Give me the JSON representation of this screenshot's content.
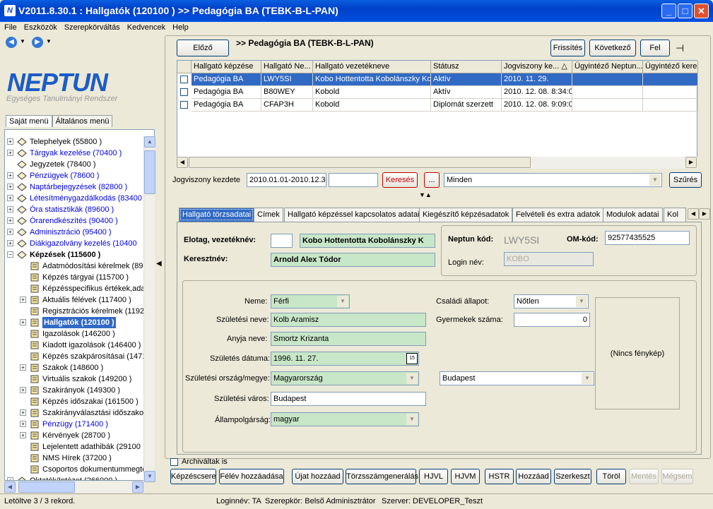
{
  "window": {
    "title": "V2011.8.30.1 : Hallgatók (120100  )  >> Pedagógia BA (TEBK-B-L-PAN)",
    "app_icon_glyph": "N"
  },
  "menu": [
    "File",
    "Eszközök",
    "Szerepkörváltás",
    "Kedvencek",
    "Help"
  ],
  "logo": {
    "text": "NEPTUN",
    "subtitle": "Egységes Tanulmányi Rendszer",
    "color": "#1a5cc8"
  },
  "left_tabs": [
    "Saját menü",
    "Általános menü"
  ],
  "tree": [
    {
      "label": "Telephelyek (55800  )",
      "blue": false,
      "level": 0,
      "exp": "+"
    },
    {
      "label": "Tárgyak kezelése (70400  )",
      "blue": true,
      "level": 0,
      "exp": "+"
    },
    {
      "label": "Jegyzetek (78400  )",
      "blue": false,
      "level": 0,
      "exp": ""
    },
    {
      "label": "Pénzügyek (78600  )",
      "blue": true,
      "level": 0,
      "exp": "+"
    },
    {
      "label": "Naptárbejegyzések (82800  )",
      "blue": true,
      "level": 0,
      "exp": "+"
    },
    {
      "label": "Létesítménygazdálkodás (83400",
      "blue": true,
      "level": 0,
      "exp": "+"
    },
    {
      "label": "Óra statisztikák (89600  )",
      "blue": true,
      "level": 0,
      "exp": "+"
    },
    {
      "label": "Órarendkészítés (90400  )",
      "blue": true,
      "level": 0,
      "exp": "+"
    },
    {
      "label": "Adminisztráció (95400  )",
      "blue": true,
      "level": 0,
      "exp": "+"
    },
    {
      "label": "Diákigazolvány kezelés (10400",
      "blue": true,
      "level": 0,
      "exp": "+"
    },
    {
      "label": "Képzések (115600  )",
      "blue": false,
      "bold": true,
      "level": 0,
      "exp": "−"
    },
    {
      "label": "Adatmódosítási kérelmek (890",
      "blue": false,
      "level": 1,
      "exp": ""
    },
    {
      "label": "Képzés tárgyai (115700  )",
      "blue": false,
      "level": 1,
      "exp": ""
    },
    {
      "label": "Képzésspecifikus értékek,ada",
      "blue": false,
      "level": 1,
      "exp": ""
    },
    {
      "label": "Aktuális félévek (117400  )",
      "blue": false,
      "level": 1,
      "exp": "+"
    },
    {
      "label": "Regisztrációs kérelmek (1192",
      "blue": false,
      "level": 1,
      "exp": ""
    },
    {
      "label": "Hallgatók (120100  )",
      "blue": false,
      "level": 1,
      "exp": "+",
      "selected": true
    },
    {
      "label": "Igazolások (146200  )",
      "blue": false,
      "level": 1,
      "exp": ""
    },
    {
      "label": "Kiadott igazolások (146400  )",
      "blue": false,
      "level": 1,
      "exp": ""
    },
    {
      "label": "Képzés szakpárosításai (1471",
      "blue": false,
      "level": 1,
      "exp": ""
    },
    {
      "label": "Szakok (148600  )",
      "blue": false,
      "level": 1,
      "exp": "+"
    },
    {
      "label": "Virtuális szakok (149200  )",
      "blue": false,
      "level": 1,
      "exp": ""
    },
    {
      "label": "Szakirányok (149300  )",
      "blue": false,
      "level": 1,
      "exp": "+"
    },
    {
      "label": "Képzés időszakai (161500  )",
      "blue": false,
      "level": 1,
      "exp": ""
    },
    {
      "label": "Szakirányválasztási időszakol",
      "blue": false,
      "level": 1,
      "exp": "+"
    },
    {
      "label": "Pénzügy (171400  )",
      "blue": true,
      "level": 1,
      "exp": "+"
    },
    {
      "label": "Kérvények (28700  )",
      "blue": false,
      "level": 1,
      "exp": "+"
    },
    {
      "label": "Lejelentett adathibák (29100",
      "blue": false,
      "level": 1,
      "exp": ""
    },
    {
      "label": "NMS Hírek (37200  )",
      "blue": false,
      "level": 1,
      "exp": ""
    },
    {
      "label": "Csoportos dokumentummegte",
      "blue": false,
      "level": 1,
      "exp": ""
    },
    {
      "label": "Oktatók/Intézet (266000  )",
      "blue": false,
      "level": 0,
      "exp": "+"
    }
  ],
  "top": {
    "prev": "Előző",
    "breadcrumb": ">> Pedagógia BA (TEBK-B-L-PAN)",
    "refresh": "Frissítés",
    "next": "Következő",
    "up": "Fel"
  },
  "grid": {
    "columns": [
      "Hallgató képzése",
      "Hallgató Ne...",
      "Hallgató vezetékneve",
      "Státusz",
      "Jogviszony ke...",
      "Ügyintéző Neptun...",
      "Ügyintéző kere"
    ],
    "rows": [
      [
        "Pedagógia BA",
        "LWY5SI",
        "Kobo Hottentotta Kobolánszky Kob",
        "Aktív",
        "2010. 11. 29.",
        "",
        ""
      ],
      [
        "Pedagógia BA",
        "B80WEY",
        "Kobold",
        "Aktív",
        "2010. 12. 08. 8:34:0",
        "",
        ""
      ],
      [
        "Pedagógia BA",
        "CFAP3H",
        "Kobold",
        "Diplomát szerzett",
        "2010. 12. 08. 9:09:0",
        "",
        ""
      ]
    ],
    "sort_indicator": "△"
  },
  "filter": {
    "label": "Jogviszony kezdete",
    "value": "2010.01.01-2010.12.3",
    "search": "Keresés",
    "ellipsis": "...",
    "select": "Minden",
    "filter_btn": "Szűrés"
  },
  "tabs": [
    "Hallgató törzsadatai",
    "Címek",
    "Hallgató képzéssel kapcsolatos adatai",
    "Kiegészítő képzésadatok",
    "Felvételi és extra adatok",
    "Modulok adatai",
    "Kol"
  ],
  "form": {
    "prefix_label": "Elotag, vezetéknév:",
    "prefix_value": "",
    "surname": "Kobo Hottentotta Kobolánszky K",
    "firstname_label": "Keresztnév:",
    "firstname": "Arnold Alex Tódor",
    "neptun_label": "Neptun kód:",
    "neptun_value": "LWY5SI",
    "om_label": "OM-kód:",
    "om_value": "92577435525",
    "login_label": "Login név:",
    "login_value": "KOBO",
    "gender_label": "Neme:",
    "gender": "Férfi",
    "birthname_label": "Születési neve:",
    "birthname": "Kolb Aramisz",
    "mother_label": "Anyja neve:",
    "mother": "Smortz Krizanta",
    "birthdate_label": "Születés dátuma:",
    "birthdate": "1996. 11. 27.",
    "cal_icon": "15",
    "country_label": "Születési ország/megye:",
    "country": "Magyarország",
    "county": "Budapest",
    "city_label": "Születési város:",
    "city": "Budapest",
    "citizen_label": "Állampolgárság:",
    "citizen": "magyar",
    "marital_label": "Családi állapot:",
    "marital": "Nőtlen",
    "children_label": "Gyermekek száma:",
    "children": "0",
    "photo": "(Nincs fénykép)"
  },
  "archived_label": "Archiváltak is",
  "buttons": [
    "Képzéscsere",
    "Félév hozzáadása",
    "Újat hozzáad",
    "Törzsszámgenerálás",
    "HJVL",
    "HJVM",
    "HSTR",
    "Hozzáad",
    "Szerkeszt",
    "Töröl",
    "Mentés",
    "Mégsem"
  ],
  "status": {
    "records": "Letöltve 3 / 3 rekord.",
    "login": "Loginnév: TA",
    "role": "Szerepkör: Belső Adminisztrátor",
    "server": "Szerver: DEVELOPER_Teszt"
  }
}
